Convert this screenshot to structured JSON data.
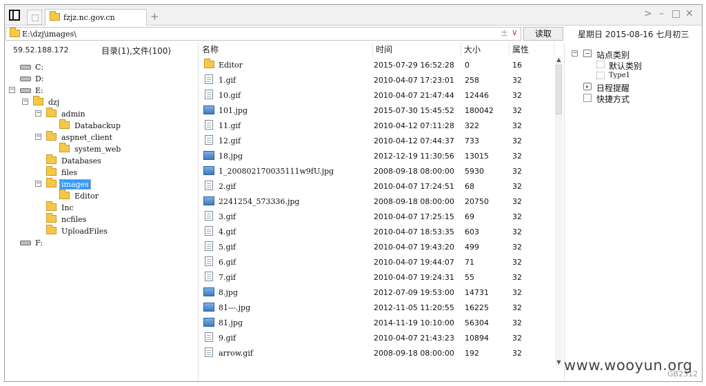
{
  "tabbar": {
    "tab_title": "fzjz.nc.gov.cn",
    "new_tab": "+",
    "forward_glyph": ">",
    "minimize_glyph": "–",
    "maximize_glyph": "□",
    "close_glyph": "✕"
  },
  "address": {
    "path": "E:\\dzj\\images\\",
    "clear_glyph": "±",
    "dropdown_glyph": "∨",
    "read_button": "读取"
  },
  "date_info": "星期日 2015-08-16 七月初三",
  "left_panel": {
    "ip": "59.52.188.172",
    "summary": "目录(1),文件(100)",
    "tree": [
      {
        "label": "C:",
        "type": "drive",
        "toggle": "",
        "selected": false
      },
      {
        "label": "D:",
        "type": "drive",
        "toggle": "",
        "selected": false
      },
      {
        "label": "E:",
        "type": "drive",
        "toggle": "−",
        "selected": false
      },
      {
        "label": "dzj",
        "type": "folder",
        "toggle": "−",
        "selected": false
      },
      {
        "label": "admin",
        "type": "folder",
        "toggle": "−",
        "selected": false
      },
      {
        "label": "Databackup",
        "type": "folder",
        "toggle": "",
        "selected": false
      },
      {
        "label": "aspnet_client",
        "type": "folder",
        "toggle": "−",
        "selected": false
      },
      {
        "label": "system_web",
        "type": "folder",
        "toggle": "",
        "selected": false
      },
      {
        "label": "Databases",
        "type": "folder",
        "toggle": "",
        "selected": false
      },
      {
        "label": "files",
        "type": "folder",
        "toggle": "",
        "selected": false
      },
      {
        "label": "images",
        "type": "folder",
        "toggle": "−",
        "selected": true
      },
      {
        "label": "Editor",
        "type": "folder",
        "toggle": "",
        "selected": false
      },
      {
        "label": "Inc",
        "type": "folder",
        "toggle": "",
        "selected": false
      },
      {
        "label": "ncfiles",
        "type": "folder",
        "toggle": "",
        "selected": false
      },
      {
        "label": "UploadFiles",
        "type": "folder",
        "toggle": "",
        "selected": false
      },
      {
        "label": "F:",
        "type": "drive",
        "toggle": "",
        "selected": false
      }
    ]
  },
  "file_list": {
    "columns": [
      "名称",
      "时间",
      "大小",
      "属性"
    ],
    "rows": [
      {
        "name": "Editor",
        "type": "folder",
        "time": "2015-07-29 16:52:28",
        "size": "0",
        "attr": "16"
      },
      {
        "name": "1.gif",
        "type": "gif",
        "time": "2010-04-07 17:23:01",
        "size": "258",
        "attr": "32"
      },
      {
        "name": "10.gif",
        "type": "gif",
        "time": "2010-04-07 21:47:44",
        "size": "12446",
        "attr": "32"
      },
      {
        "name": "101.jpg",
        "type": "jpg",
        "time": "2015-07-30 15:45:52",
        "size": "180042",
        "attr": "32"
      },
      {
        "name": "11.gif",
        "type": "gif",
        "time": "2010-04-12 07:11:28",
        "size": "322",
        "attr": "32"
      },
      {
        "name": "12.gif",
        "type": "gif",
        "time": "2010-04-12 07:44:37",
        "size": "733",
        "attr": "32"
      },
      {
        "name": "18.jpg",
        "type": "jpg",
        "time": "2012-12-19 11:30:56",
        "size": "13015",
        "attr": "32"
      },
      {
        "name": "1_200802170035111w9fU.jpg",
        "type": "jpg",
        "time": "2008-09-18 08:00:00",
        "size": "5930",
        "attr": "32"
      },
      {
        "name": "2.gif",
        "type": "gif",
        "time": "2010-04-07 17:24:51",
        "size": "68",
        "attr": "32"
      },
      {
        "name": "2241254_573336.jpg",
        "type": "jpg",
        "time": "2008-09-18 08:00:00",
        "size": "20750",
        "attr": "32"
      },
      {
        "name": "3.gif",
        "type": "gif",
        "time": "2010-04-07 17:25:15",
        "size": "69",
        "attr": "32"
      },
      {
        "name": "4.gif",
        "type": "gif",
        "time": "2010-04-07 18:53:35",
        "size": "603",
        "attr": "32"
      },
      {
        "name": "5.gif",
        "type": "gif",
        "time": "2010-04-07 19:43:20",
        "size": "499",
        "attr": "32"
      },
      {
        "name": "6.gif",
        "type": "gif",
        "time": "2010-04-07 19:44:07",
        "size": "71",
        "attr": "32"
      },
      {
        "name": "7.gif",
        "type": "gif",
        "time": "2010-04-07 19:24:31",
        "size": "55",
        "attr": "32"
      },
      {
        "name": "8.jpg",
        "type": "jpg",
        "time": "2012-07-09 19:53:00",
        "size": "14731",
        "attr": "32"
      },
      {
        "name": "81---.jpg",
        "type": "jpg",
        "time": "2012-11-05 11:20:55",
        "size": "16225",
        "attr": "32"
      },
      {
        "name": "81.jpg",
        "type": "jpg",
        "time": "2014-11-19 10:10:00",
        "size": "56304",
        "attr": "32"
      },
      {
        "name": "9.gif",
        "type": "gif",
        "time": "2010-04-07 21:43:23",
        "size": "10894",
        "attr": "32"
      },
      {
        "name": "arrow.gif",
        "type": "gif",
        "time": "2008-09-18 08:00:00",
        "size": "192",
        "attr": "32"
      }
    ]
  },
  "right_panel": {
    "site_category": "站点类别",
    "site_category_toggle": "−",
    "default_category": "默认类别",
    "type1": "Type1",
    "reminder": "日程提醒",
    "shortcuts": "快捷方式"
  },
  "status": {
    "codepage": "GB2312"
  },
  "watermark": "www.wooyun.org"
}
